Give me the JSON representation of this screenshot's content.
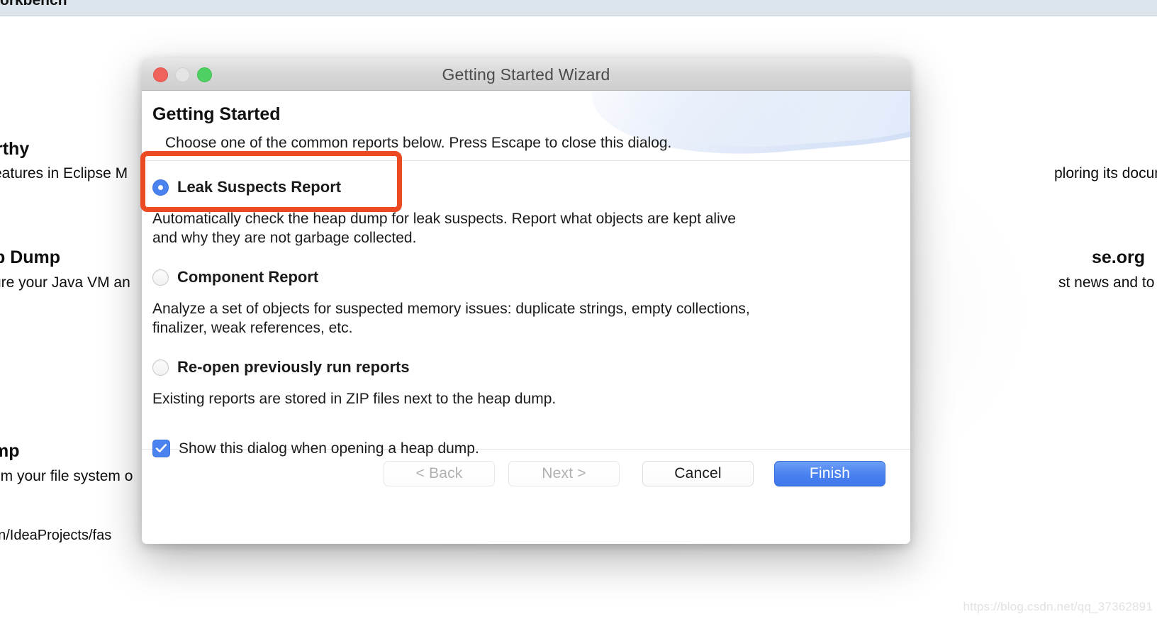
{
  "backdrop": {
    "workbench_title": "orkbench",
    "watermark": "https://blog.csdn.net/qq_37362891",
    "texts": {
      "heading_1": "rthy",
      "para_1": "eatures in Eclipse M",
      "heading_2": "p Dump",
      "para_2": "ure your Java VM an",
      "heading_3": "mp",
      "para_3": "om your file system o",
      "para_4": "an/IdeaProjects/fas",
      "right_para_1": "ploring its documentation.",
      "right_heading_1": "se.org",
      "right_para_2": "st news and to download the"
    }
  },
  "dialog": {
    "window_title": "Getting Started Wizard",
    "traffic_lights": {
      "close": "close-button",
      "minimize": "minimize-button",
      "maximize": "maximize-button"
    },
    "heading": "Getting Started",
    "subheading": "Choose one of the common reports below. Press Escape to close this dialog.",
    "options": [
      {
        "id": "leak-suspects-report",
        "label": "Leak Suspects Report",
        "selected": true,
        "description": "Automatically check the heap dump for leak suspects. Report what objects are kept alive and why they are not garbage collected."
      },
      {
        "id": "component-report",
        "label": "Component Report",
        "selected": false,
        "description": "Analyze a set of objects for suspected memory issues: duplicate strings, empty collections, finalizer, weak references, etc."
      },
      {
        "id": "re-open-previously-run-reports",
        "label": "Re-open previously run reports",
        "selected": false,
        "description": "Existing reports are stored in ZIP files next to the heap dump."
      }
    ],
    "checkbox": {
      "label": "Show this dialog when opening a heap dump.",
      "checked": true
    },
    "buttons": {
      "back": "< Back",
      "next": "Next >",
      "cancel": "Cancel",
      "finish": "Finish"
    }
  },
  "annotation": {
    "color": "#ec4a22",
    "target": "leak-suspects-report"
  },
  "colors": {
    "accent_blue": "#4a82f0",
    "primary_button": "#4b82ef",
    "annotation_orange": "#ec4a22",
    "workbench_bar": "#dce5ec"
  }
}
